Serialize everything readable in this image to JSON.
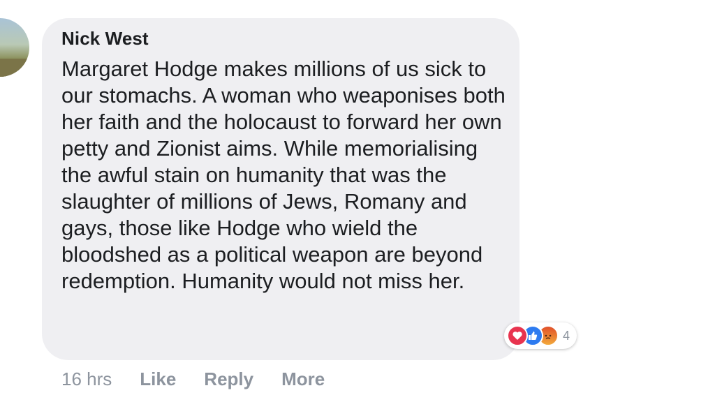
{
  "comment": {
    "author": "Nick West",
    "text": "Margaret Hodge makes millions of us sick to our stomachs. A woman who weaponises both her faith and the holocaust to forward her own petty and Zionist aims. While memorialising the awful stain on humanity that was the slaughter of millions of Jews, Romany and gays, those like Hodge who wield the bloodshed as a political weapon are beyond redemption. Humanity would not miss her.",
    "timestamp": "16 hrs",
    "actions": {
      "like": "Like",
      "reply": "Reply",
      "more": "More"
    },
    "reactions": {
      "types": [
        "love-icon",
        "like-icon",
        "angry-icon"
      ],
      "count": "4"
    }
  }
}
